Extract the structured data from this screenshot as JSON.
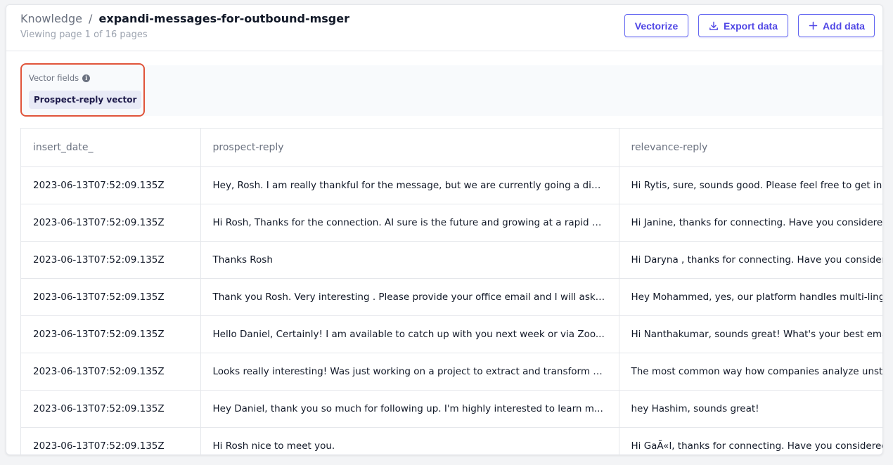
{
  "header": {
    "breadcrumb_root": "Knowledge",
    "breadcrumb_separator": "/",
    "breadcrumb_current": "expandi-messages-for-outbound-msger",
    "subtitle": "Viewing page 1 of 16 pages"
  },
  "actions": {
    "vectorize_label": "Vectorize",
    "export_label": "Export data",
    "add_label": "Add data",
    "export_icon": "download-icon",
    "add_icon": "plus-icon"
  },
  "vector_fields": {
    "title": "Vector fields",
    "chips": [
      "Prospect-reply vector"
    ],
    "highlight_color": "#e0543a"
  },
  "table": {
    "columns": [
      "insert_date_",
      "prospect-reply",
      "relevance-reply"
    ],
    "rows": [
      [
        "2023-06-13T07:52:09.135Z",
        "Hey, Rosh. I am really thankful for the message, but we are currently going a diff...",
        "Hi Rytis, sure, sounds good. Please feel free to get in t"
      ],
      [
        "2023-06-13T07:52:09.135Z",
        "Hi Rosh, Thanks for the connection. AI sure is the future and growing at a rapid p...",
        "Hi Janine, thanks for connecting. Have you considered"
      ],
      [
        "2023-06-13T07:52:09.135Z",
        "Thanks Rosh",
        "Hi Daryna , thanks for connecting. Have you considere"
      ],
      [
        "2023-06-13T07:52:09.135Z",
        "Thank you Rosh. Very interesting . Please provide your office email and I will ask ...",
        "Hey Mohammed, yes, our platform handles multi-ling"
      ],
      [
        "2023-06-13T07:52:09.135Z",
        "Hello Daniel, Certainly! I am available to catch up with you next week or via Zoo...",
        "Hi Nanthakumar, sounds great! What's your best emai"
      ],
      [
        "2023-06-13T07:52:09.135Z",
        "Looks really interesting! Was just working on a project to extract and transform d...",
        "The most common way how companies analyze unstru"
      ],
      [
        "2023-06-13T07:52:09.135Z",
        "Hey Daniel, thank you so much for following up. I'm highly interested to learn m...",
        "hey Hashim, sounds great!"
      ],
      [
        "2023-06-13T07:52:09.135Z",
        "Hi Rosh nice to meet you.",
        "Hi GaÃ«l, thanks for connecting. Have you considered"
      ]
    ]
  },
  "colors": {
    "accent": "#4f46e5",
    "chip_bg": "#e8eaf6"
  }
}
